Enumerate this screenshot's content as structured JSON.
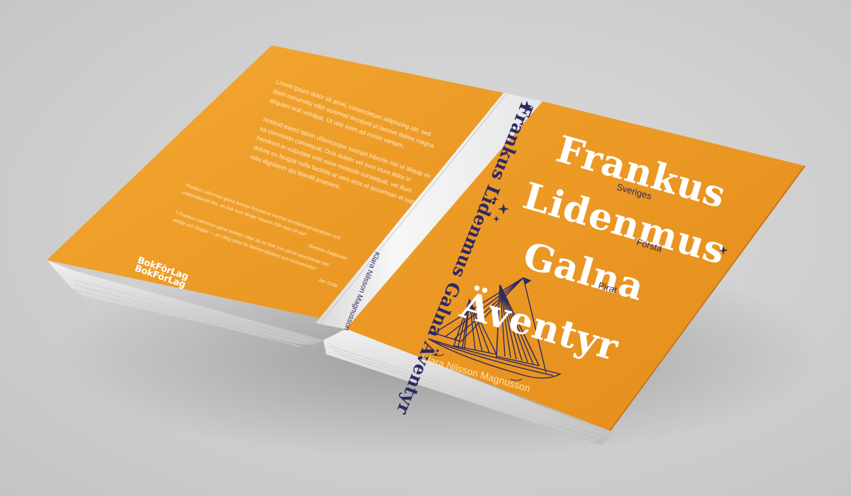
{
  "back_cover": {
    "paragraphs": [
      "Lorem ipsum dolor sit amet, consectetuer adipiscing elit, sed diam nonummy nibh euismod tincidunt ut laoreet dolore magna aliquam erat volutpat. Ut wisi enim ad minim veniam,",
      "nostrud exerci tation ullamcorper suscipit lobortis nisl ut aliquip ex ea commodo consequat. Duis autem vel eum iriure dolor in hendrerit in vulputate velit esse molestie consequat, vel illum dolore eu feugiat nulla facilisis at vero eros et accumsan et iusto odio dignissim qui blandit praesent."
    ],
    "quotes": [
      "\"Frankus Lidenmus galna äventyr fascinerar med en kombinerad berättelse och underhållande lins, en bok som fånger läsaren från start till slut\"",
      "Svenska Dagbladet",
      "\"I Frankus Lidenmus galna äventyr hittar du en bok som på ett anarrkande sätt skildar och längtar — en riktig pärla för äventyrsälskare och historiefolder\"",
      "Jan Gulla"
    ],
    "publisher_lines": [
      "BokFörLag",
      "BokFörLag"
    ]
  },
  "spine": {
    "title": "Frankus Lidenmus Galna Äventyr",
    "author": "Klara Nilsson Magnusson"
  },
  "front_cover": {
    "title_words": [
      "Frankus",
      "Lidenmus",
      "Galna",
      "Äventyr"
    ],
    "subtitle_words": [
      "Sveriges",
      "Första",
      "Pirat"
    ],
    "author": "Klara Nilsson Magnusson"
  },
  "colors": {
    "cover_orange": "#f09d28",
    "cover_orange_dark": "#e58f1e",
    "spine_white": "#f2f2f2",
    "ink_navy": "#2c2a63",
    "background": "#d4d4d4"
  }
}
